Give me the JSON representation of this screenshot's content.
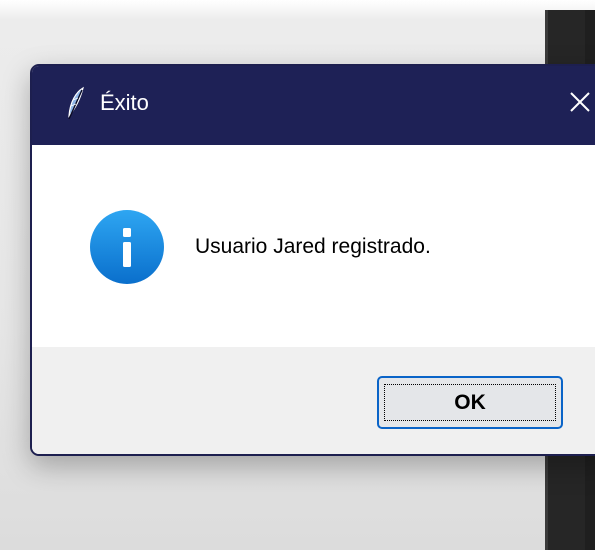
{
  "dialog": {
    "title": "Éxito",
    "title_icon": "feather-icon",
    "close_icon": "close-icon",
    "message_icon": "info-icon",
    "message": "Usuario Jared registrado.",
    "ok_label": "OK"
  },
  "colors": {
    "titlebar": "#1e2156",
    "info_icon": "#1183dc",
    "button_border": "#0a64c8",
    "button_bg": "#e4e6e9",
    "footer_bg": "#f0f0f0"
  }
}
